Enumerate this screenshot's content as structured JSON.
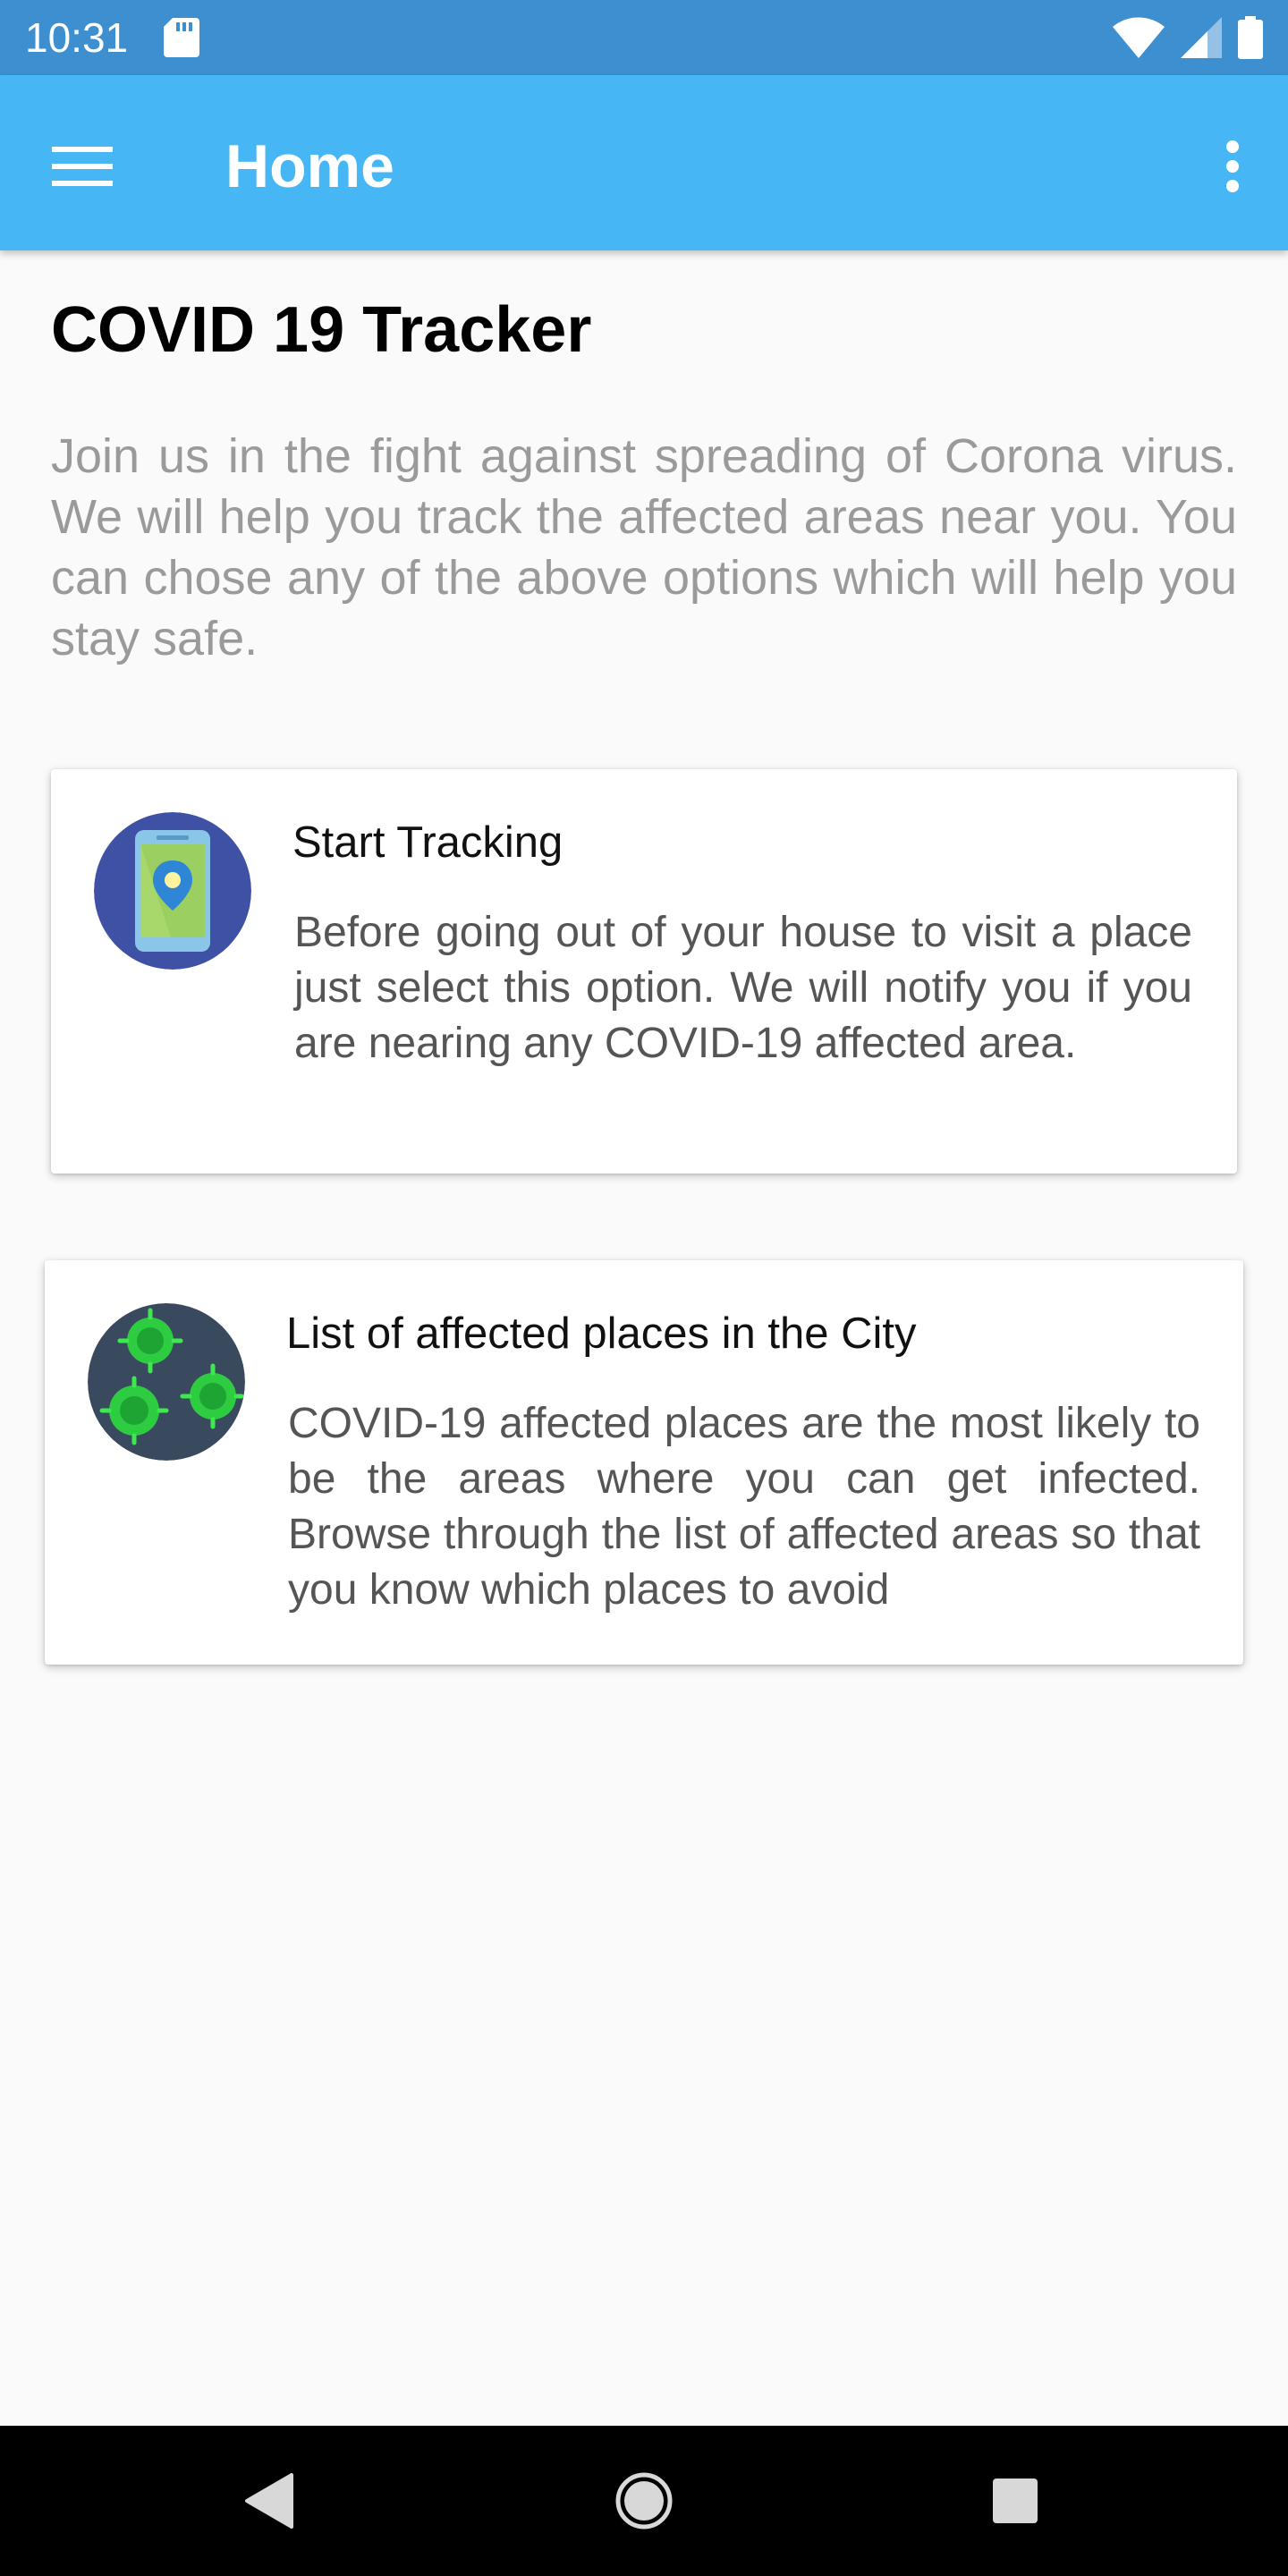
{
  "status_bar": {
    "time": "10:31",
    "icons": [
      "sd-card-icon",
      "wifi-icon",
      "signal-icon",
      "battery-icon"
    ]
  },
  "app_bar": {
    "title": "Home",
    "color": "#47b6f5",
    "icons": [
      "hamburger-menu-icon",
      "more-vert-icon"
    ]
  },
  "main": {
    "title": "COVID 19 Tracker",
    "intro": "Join us in the fight against spreading of Corona virus. We will help you track the affected areas near you. You can chose any of the above options which will help you stay safe.",
    "cards": [
      {
        "icon": "phone-location-icon",
        "title": "Start Tracking",
        "description": "Before going out of your house to visit a place just select this option. We will notify you if you are nearing any COVID-19 affected area."
      },
      {
        "icon": "virus-icon",
        "title": "List of affected places in the City",
        "description": "COVID-19 affected places are the most likely to be the areas where you can get infected. Browse through the list of affected areas so that you know which places to avoid"
      }
    ]
  },
  "nav_bar": {
    "icons": [
      "back-icon",
      "home-icon",
      "recents-icon"
    ]
  }
}
